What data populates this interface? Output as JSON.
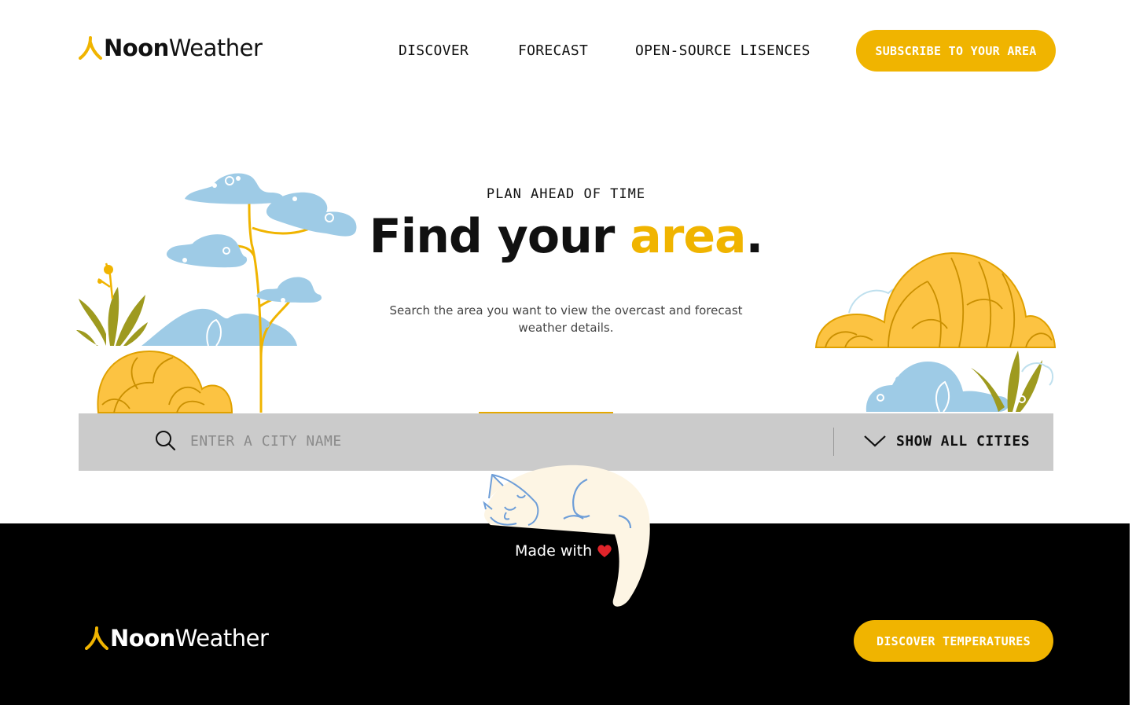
{
  "header": {
    "logo": {
      "part1": "Noon",
      "part2": "Weather"
    },
    "nav": [
      {
        "label": "DISCOVER"
      },
      {
        "label": "FORECAST"
      },
      {
        "label": "OPEN-SOURCE LISENCES"
      }
    ],
    "cta_label": "SUBSCRIBE TO YOUR AREA"
  },
  "hero": {
    "eyebrow": "PLAN AHEAD OF TIME",
    "title_part1": "Find your ",
    "title_accent": "area",
    "title_end": ".",
    "subtitle": "Search the area you want to view the overcast and forecast weather details."
  },
  "search": {
    "placeholder": "ENTER A CITY NAME",
    "value": "",
    "show_all_label": "SHOW ALL CITIES",
    "search_icon": "search-icon",
    "chevron_icon": "chevron-down-icon"
  },
  "footer": {
    "made_with": "Made with",
    "heart_icon": "heart-icon",
    "logo": {
      "part1": "Noon",
      "part2": "Weather"
    },
    "cta_label": "DISCOVER TEMPERATURES"
  },
  "colors": {
    "accent": "#f0b400",
    "text": "#111111",
    "search_bg": "#cbcbcb",
    "footer_bg": "#000000",
    "illustration_blue": "#9ecbe6",
    "illustration_olive": "#9e9a1f"
  }
}
